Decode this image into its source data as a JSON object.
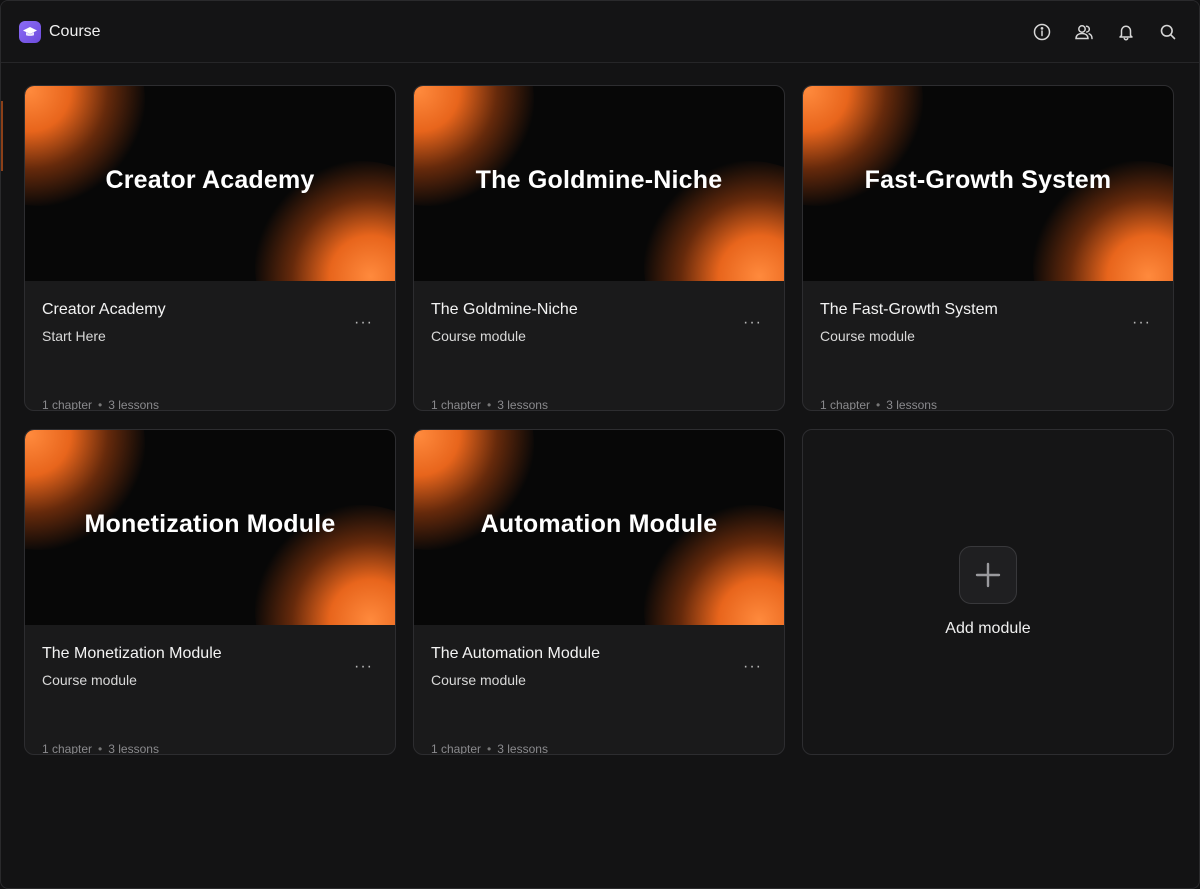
{
  "app": {
    "title": "Course"
  },
  "header": {
    "actions": [
      {
        "icon": "info-icon"
      },
      {
        "icon": "users-icon"
      },
      {
        "icon": "bell-icon"
      },
      {
        "icon": "search-icon"
      }
    ]
  },
  "colors": {
    "accent": "#ff7a2f",
    "brand": "#7c5cf0",
    "background": "#131314",
    "card": "#1a1a1b"
  },
  "modules": [
    {
      "thumb_title": "Creator Academy",
      "title": "Creator Academy",
      "subtitle": "Start Here",
      "chapters": "1 chapter",
      "lessons": "3 lessons",
      "more": "···"
    },
    {
      "thumb_title": "The Goldmine-Niche",
      "title": "The Goldmine-Niche",
      "subtitle": "Course module",
      "chapters": "1 chapter",
      "lessons": "3 lessons",
      "more": "···"
    },
    {
      "thumb_title": "Fast-Growth System",
      "title": "The Fast-Growth System",
      "subtitle": "Course module",
      "chapters": "1 chapter",
      "lessons": "3 lessons",
      "more": "···"
    },
    {
      "thumb_title": "Monetization Module",
      "title": "The Monetization Module",
      "subtitle": "Course module",
      "chapters": "1 chapter",
      "lessons": "3 lessons",
      "more": "···"
    },
    {
      "thumb_title": "Automation Module",
      "title": "The Automation Module",
      "subtitle": "Course module",
      "chapters": "1 chapter",
      "lessons": "3 lessons",
      "more": "···"
    }
  ],
  "add_module": {
    "label": "Add module",
    "icon": "plus-icon"
  },
  "meta_separator": "•"
}
